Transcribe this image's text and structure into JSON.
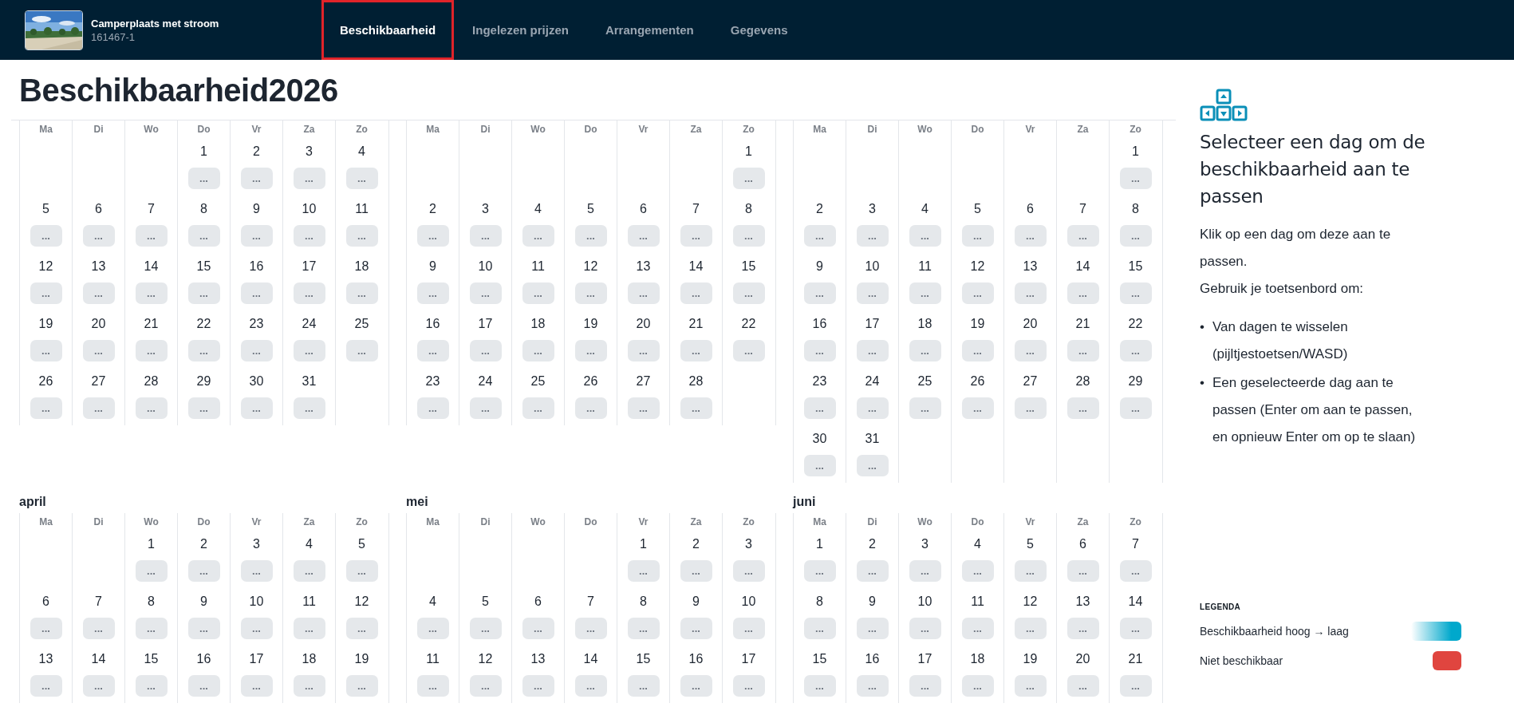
{
  "header": {
    "listing_title": "Camperplaats met stroom",
    "listing_code": "161467-1"
  },
  "tabs": [
    {
      "label": "Beschikbaarheid",
      "selected": true
    },
    {
      "label": "Ingelezen prijzen",
      "selected": false
    },
    {
      "label": "Arrangementen",
      "selected": false
    },
    {
      "label": "Gegevens",
      "selected": false
    }
  ],
  "page_title": "Beschikbaarheid2026",
  "month_rows": [
    {
      "months": [
        {
          "weekdays": [
            "Ma",
            "Di",
            "Wo",
            "Do",
            "Vr",
            "Za",
            "Zo"
          ],
          "weeks": [
            [
              {
                "kind": "empty"
              },
              {
                "kind": "empty"
              },
              {
                "kind": "empty"
              },
              {
                "kind": "day",
                "day": "1",
                "label": "..."
              },
              {
                "kind": "day",
                "day": "2",
                "label": "..."
              },
              {
                "kind": "day",
                "day": "3",
                "label": "..."
              },
              {
                "kind": "day",
                "day": "4",
                "label": "..."
              }
            ],
            [
              {
                "kind": "day",
                "day": "5",
                "label": "..."
              },
              {
                "kind": "day",
                "day": "6",
                "label": "..."
              },
              {
                "kind": "day",
                "day": "7",
                "label": "..."
              },
              {
                "kind": "day",
                "day": "8",
                "label": "..."
              },
              {
                "kind": "day",
                "day": "9",
                "label": "..."
              },
              {
                "kind": "day",
                "day": "10",
                "label": "..."
              },
              {
                "kind": "day",
                "day": "11",
                "label": "..."
              }
            ],
            [
              {
                "kind": "day",
                "day": "12",
                "label": "..."
              },
              {
                "kind": "day",
                "day": "13",
                "label": "..."
              },
              {
                "kind": "day",
                "day": "14",
                "label": "..."
              },
              {
                "kind": "day",
                "day": "15",
                "label": "..."
              },
              {
                "kind": "day",
                "day": "16",
                "label": "..."
              },
              {
                "kind": "day",
                "day": "17",
                "label": "..."
              },
              {
                "kind": "day",
                "day": "18",
                "label": "..."
              }
            ],
            [
              {
                "kind": "day",
                "day": "19",
                "label": "..."
              },
              {
                "kind": "day",
                "day": "20",
                "label": "..."
              },
              {
                "kind": "day",
                "day": "21",
                "label": "..."
              },
              {
                "kind": "day",
                "day": "22",
                "label": "..."
              },
              {
                "kind": "day",
                "day": "23",
                "label": "..."
              },
              {
                "kind": "day",
                "day": "24",
                "label": "..."
              },
              {
                "kind": "day",
                "day": "25",
                "label": "..."
              }
            ],
            [
              {
                "kind": "day",
                "day": "26",
                "label": "..."
              },
              {
                "kind": "day",
                "day": "27",
                "label": "..."
              },
              {
                "kind": "day",
                "day": "28",
                "label": "..."
              },
              {
                "kind": "day",
                "day": "29",
                "label": "..."
              },
              {
                "kind": "day",
                "day": "30",
                "label": "..."
              },
              {
                "kind": "day",
                "day": "31",
                "label": "..."
              },
              {
                "kind": "empty"
              }
            ]
          ]
        },
        {
          "weekdays": [
            "Ma",
            "Di",
            "Wo",
            "Do",
            "Vr",
            "Za",
            "Zo"
          ],
          "weeks": [
            [
              {
                "kind": "empty"
              },
              {
                "kind": "empty"
              },
              {
                "kind": "empty"
              },
              {
                "kind": "empty"
              },
              {
                "kind": "empty"
              },
              {
                "kind": "empty"
              },
              {
                "kind": "day",
                "day": "1",
                "label": "..."
              }
            ],
            [
              {
                "kind": "day",
                "day": "2",
                "label": "..."
              },
              {
                "kind": "day",
                "day": "3",
                "label": "..."
              },
              {
                "kind": "day",
                "day": "4",
                "label": "..."
              },
              {
                "kind": "day",
                "day": "5",
                "label": "..."
              },
              {
                "kind": "day",
                "day": "6",
                "label": "..."
              },
              {
                "kind": "day",
                "day": "7",
                "label": "..."
              },
              {
                "kind": "day",
                "day": "8",
                "label": "..."
              }
            ],
            [
              {
                "kind": "day",
                "day": "9",
                "label": "..."
              },
              {
                "kind": "day",
                "day": "10",
                "label": "..."
              },
              {
                "kind": "day",
                "day": "11",
                "label": "..."
              },
              {
                "kind": "day",
                "day": "12",
                "label": "..."
              },
              {
                "kind": "day",
                "day": "13",
                "label": "..."
              },
              {
                "kind": "day",
                "day": "14",
                "label": "..."
              },
              {
                "kind": "day",
                "day": "15",
                "label": "..."
              }
            ],
            [
              {
                "kind": "day",
                "day": "16",
                "label": "..."
              },
              {
                "kind": "day",
                "day": "17",
                "label": "..."
              },
              {
                "kind": "day",
                "day": "18",
                "label": "..."
              },
              {
                "kind": "day",
                "day": "19",
                "label": "..."
              },
              {
                "kind": "day",
                "day": "20",
                "label": "..."
              },
              {
                "kind": "day",
                "day": "21",
                "label": "..."
              },
              {
                "kind": "day",
                "day": "22",
                "label": "..."
              }
            ],
            [
              {
                "kind": "day",
                "day": "23",
                "label": "..."
              },
              {
                "kind": "day",
                "day": "24",
                "label": "..."
              },
              {
                "kind": "day",
                "day": "25",
                "label": "..."
              },
              {
                "kind": "day",
                "day": "26",
                "label": "..."
              },
              {
                "kind": "day",
                "day": "27",
                "label": "..."
              },
              {
                "kind": "day",
                "day": "28",
                "label": "..."
              },
              {
                "kind": "empty"
              }
            ]
          ]
        },
        {
          "weekdays": [
            "Ma",
            "Di",
            "Wo",
            "Do",
            "Vr",
            "Za",
            "Zo"
          ],
          "weeks": [
            [
              {
                "kind": "empty"
              },
              {
                "kind": "empty"
              },
              {
                "kind": "empty"
              },
              {
                "kind": "empty"
              },
              {
                "kind": "empty"
              },
              {
                "kind": "empty"
              },
              {
                "kind": "day",
                "day": "1",
                "label": "..."
              }
            ],
            [
              {
                "kind": "day",
                "day": "2",
                "label": "..."
              },
              {
                "kind": "day",
                "day": "3",
                "label": "..."
              },
              {
                "kind": "day",
                "day": "4",
                "label": "..."
              },
              {
                "kind": "day",
                "day": "5",
                "label": "..."
              },
              {
                "kind": "day",
                "day": "6",
                "label": "..."
              },
              {
                "kind": "day",
                "day": "7",
                "label": "..."
              },
              {
                "kind": "day",
                "day": "8",
                "label": "..."
              }
            ],
            [
              {
                "kind": "day",
                "day": "9",
                "label": "..."
              },
              {
                "kind": "day",
                "day": "10",
                "label": "..."
              },
              {
                "kind": "day",
                "day": "11",
                "label": "..."
              },
              {
                "kind": "day",
                "day": "12",
                "label": "..."
              },
              {
                "kind": "day",
                "day": "13",
                "label": "..."
              },
              {
                "kind": "day",
                "day": "14",
                "label": "..."
              },
              {
                "kind": "day",
                "day": "15",
                "label": "..."
              }
            ],
            [
              {
                "kind": "day",
                "day": "16",
                "label": "..."
              },
              {
                "kind": "day",
                "day": "17",
                "label": "..."
              },
              {
                "kind": "day",
                "day": "18",
                "label": "..."
              },
              {
                "kind": "day",
                "day": "19",
                "label": "..."
              },
              {
                "kind": "day",
                "day": "20",
                "label": "..."
              },
              {
                "kind": "day",
                "day": "21",
                "label": "..."
              },
              {
                "kind": "day",
                "day": "22",
                "label": "..."
              }
            ],
            [
              {
                "kind": "day",
                "day": "23",
                "label": "..."
              },
              {
                "kind": "day",
                "day": "24",
                "label": "..."
              },
              {
                "kind": "day",
                "day": "25",
                "label": "..."
              },
              {
                "kind": "day",
                "day": "26",
                "label": "..."
              },
              {
                "kind": "day",
                "day": "27",
                "label": "..."
              },
              {
                "kind": "day",
                "day": "28",
                "label": "..."
              },
              {
                "kind": "day",
                "day": "29",
                "label": "..."
              }
            ],
            [
              {
                "kind": "day",
                "day": "30",
                "label": "..."
              },
              {
                "kind": "day",
                "day": "31",
                "label": "..."
              },
              {
                "kind": "empty"
              },
              {
                "kind": "empty"
              },
              {
                "kind": "empty"
              },
              {
                "kind": "empty"
              },
              {
                "kind": "empty"
              }
            ]
          ]
        }
      ]
    },
    {
      "months": [
        {
          "name": "april",
          "weekdays": [
            "Ma",
            "Di",
            "Wo",
            "Do",
            "Vr",
            "Za",
            "Zo"
          ],
          "weeks": [
            [
              {
                "kind": "empty"
              },
              {
                "kind": "empty"
              },
              {
                "kind": "day",
                "day": "1",
                "label": "..."
              },
              {
                "kind": "day",
                "day": "2",
                "label": "..."
              },
              {
                "kind": "day",
                "day": "3",
                "label": "..."
              },
              {
                "kind": "day",
                "day": "4",
                "label": "..."
              },
              {
                "kind": "day",
                "day": "5",
                "label": "..."
              }
            ],
            [
              {
                "kind": "day",
                "day": "6",
                "label": "..."
              },
              {
                "kind": "day",
                "day": "7",
                "label": "..."
              },
              {
                "kind": "day",
                "day": "8",
                "label": "..."
              },
              {
                "kind": "day",
                "day": "9",
                "label": "..."
              },
              {
                "kind": "day",
                "day": "10",
                "label": "..."
              },
              {
                "kind": "day",
                "day": "11",
                "label": "..."
              },
              {
                "kind": "day",
                "day": "12",
                "label": "..."
              }
            ],
            [
              {
                "kind": "day",
                "day": "13",
                "label": "..."
              },
              {
                "kind": "day",
                "day": "14",
                "label": "..."
              },
              {
                "kind": "day",
                "day": "15",
                "label": "..."
              },
              {
                "kind": "day",
                "day": "16",
                "label": "..."
              },
              {
                "kind": "day",
                "day": "17",
                "label": "..."
              },
              {
                "kind": "day",
                "day": "18",
                "label": "..."
              },
              {
                "kind": "day",
                "day": "19",
                "label": "..."
              }
            ]
          ]
        },
        {
          "name": "mei",
          "weekdays": [
            "Ma",
            "Di",
            "Wo",
            "Do",
            "Vr",
            "Za",
            "Zo"
          ],
          "weeks": [
            [
              {
                "kind": "empty"
              },
              {
                "kind": "empty"
              },
              {
                "kind": "empty"
              },
              {
                "kind": "empty"
              },
              {
                "kind": "day",
                "day": "1",
                "label": "..."
              },
              {
                "kind": "day",
                "day": "2",
                "label": "..."
              },
              {
                "kind": "day",
                "day": "3",
                "label": "..."
              }
            ],
            [
              {
                "kind": "day",
                "day": "4",
                "label": "..."
              },
              {
                "kind": "day",
                "day": "5",
                "label": "..."
              },
              {
                "kind": "day",
                "day": "6",
                "label": "..."
              },
              {
                "kind": "day",
                "day": "7",
                "label": "..."
              },
              {
                "kind": "day",
                "day": "8",
                "label": "..."
              },
              {
                "kind": "day",
                "day": "9",
                "label": "..."
              },
              {
                "kind": "day",
                "day": "10",
                "label": "..."
              }
            ],
            [
              {
                "kind": "day",
                "day": "11",
                "label": "..."
              },
              {
                "kind": "day",
                "day": "12",
                "label": "..."
              },
              {
                "kind": "day",
                "day": "13",
                "label": "..."
              },
              {
                "kind": "day",
                "day": "14",
                "label": "..."
              },
              {
                "kind": "day",
                "day": "15",
                "label": "..."
              },
              {
                "kind": "day",
                "day": "16",
                "label": "..."
              },
              {
                "kind": "day",
                "day": "17",
                "label": "..."
              }
            ]
          ]
        },
        {
          "name": "juni",
          "weekdays": [
            "Ma",
            "Di",
            "Wo",
            "Do",
            "Vr",
            "Za",
            "Zo"
          ],
          "weeks": [
            [
              {
                "kind": "day",
                "day": "1",
                "label": "..."
              },
              {
                "kind": "day",
                "day": "2",
                "label": "..."
              },
              {
                "kind": "day",
                "day": "3",
                "label": "..."
              },
              {
                "kind": "day",
                "day": "4",
                "label": "..."
              },
              {
                "kind": "day",
                "day": "5",
                "label": "..."
              },
              {
                "kind": "day",
                "day": "6",
                "label": "..."
              },
              {
                "kind": "day",
                "day": "7",
                "label": "..."
              }
            ],
            [
              {
                "kind": "day",
                "day": "8",
                "label": "..."
              },
              {
                "kind": "day",
                "day": "9",
                "label": "..."
              },
              {
                "kind": "day",
                "day": "10",
                "label": "..."
              },
              {
                "kind": "day",
                "day": "11",
                "label": "..."
              },
              {
                "kind": "day",
                "day": "12",
                "label": "..."
              },
              {
                "kind": "day",
                "day": "13",
                "label": "..."
              },
              {
                "kind": "day",
                "day": "14",
                "label": "..."
              }
            ],
            [
              {
                "kind": "day",
                "day": "15",
                "label": "..."
              },
              {
                "kind": "day",
                "day": "16",
                "label": "..."
              },
              {
                "kind": "day",
                "day": "17",
                "label": "..."
              },
              {
                "kind": "day",
                "day": "18",
                "label": "..."
              },
              {
                "kind": "day",
                "day": "19",
                "label": "..."
              },
              {
                "kind": "day",
                "day": "20",
                "label": "..."
              },
              {
                "kind": "day",
                "day": "21",
                "label": "..."
              }
            ]
          ]
        }
      ]
    }
  ],
  "help": {
    "heading": "Selecteer een dag om de beschikbaarheid aan te passen",
    "intro": "Klik op een dag om deze aan te passen.",
    "keyboard_line": "Gebruik je toetsenbord om:",
    "bullets": [
      {
        "marker": "•",
        "text": "Van dagen te wisselen (pijltjestoetsen/WASD)"
      },
      {
        "marker": "•",
        "text": "Een geselecteerde dag aan te passen (Enter om aan te passen, en opnieuw Enter om op te slaan)"
      }
    ]
  },
  "legend": {
    "title": "LEGENDA",
    "items": [
      {
        "label": "Beschikbaarheid hoog → laag",
        "kind": "gradient",
        "color": "#00a8cc"
      },
      {
        "label": "Niet beschikbaar",
        "kind": "solid",
        "color": "#e0453f"
      }
    ]
  }
}
